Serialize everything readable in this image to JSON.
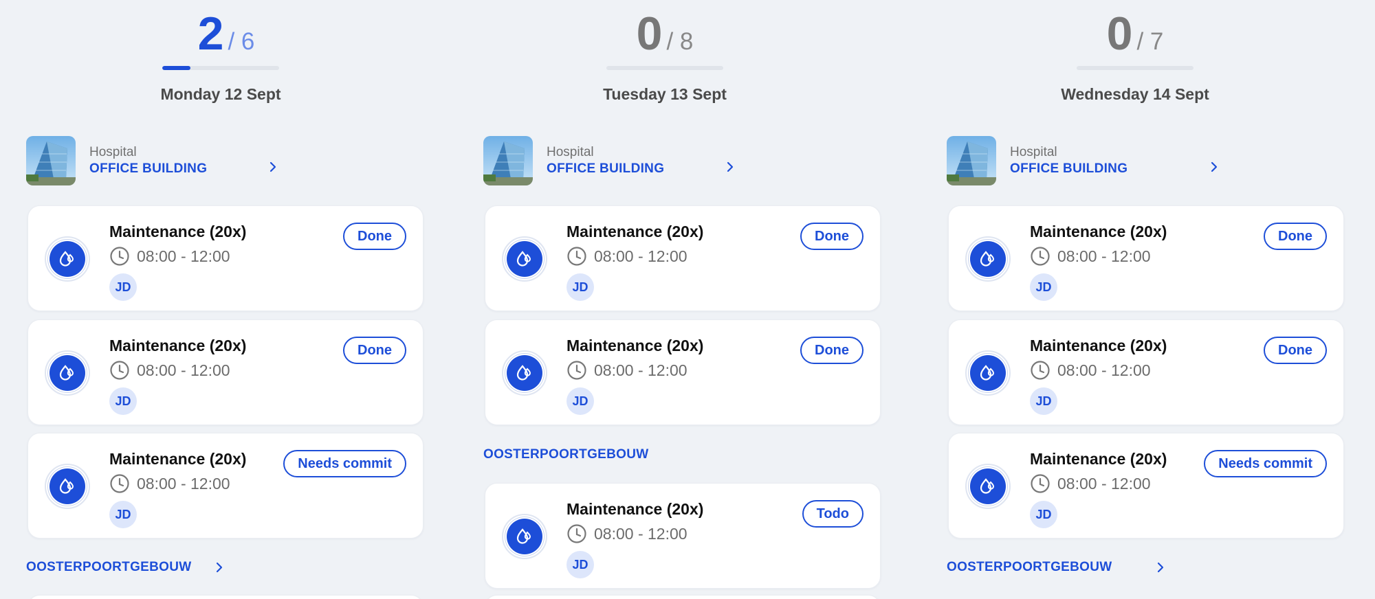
{
  "columns": [
    {
      "done": "2",
      "total": "/ 6",
      "progress": 0.33,
      "day": "Monday 12 Sept",
      "building": {
        "type": "Hospital",
        "name": "OFFICE BUILDING"
      },
      "tasks": [
        {
          "title": "Maintenance (20x)",
          "time": "08:00 - 12:00",
          "assignee": "JD",
          "status": "Done"
        },
        {
          "title": "Maintenance (20x)",
          "time": "08:00 - 12:00",
          "assignee": "JD",
          "status": "Done"
        },
        {
          "title": "Maintenance (20x)",
          "time": "08:00 - 12:00",
          "assignee": "JD",
          "status": "Needs commit"
        }
      ],
      "group": "OOSTERPOORTGEBOUW"
    },
    {
      "done": "0",
      "total": "/ 8",
      "progress": 0,
      "day": "Tuesday 13 Sept",
      "building": {
        "type": "Hospital",
        "name": "OFFICE BUILDING"
      },
      "tasks": [
        {
          "title": "Maintenance (20x)",
          "time": "08:00 - 12:00",
          "assignee": "JD",
          "status": "Done"
        },
        {
          "title": "Maintenance (20x)",
          "time": "08:00 - 12:00",
          "assignee": "JD",
          "status": "Done"
        },
        {
          "title": "Maintenance (20x)",
          "time": "08:00 - 12:00",
          "assignee": "JD",
          "status": "Todo"
        }
      ],
      "group": "OOSTERPOORTGEBOUW"
    },
    {
      "done": "0",
      "total": "/ 7",
      "progress": 0,
      "day": "Wednesday 14 Sept",
      "building": {
        "type": "Hospital",
        "name": "OFFICE BUILDING"
      },
      "tasks": [
        {
          "title": "Maintenance (20x)",
          "time": "08:00 - 12:00",
          "assignee": "JD",
          "status": "Done"
        },
        {
          "title": "Maintenance (20x)",
          "time": "08:00 - 12:00",
          "assignee": "JD",
          "status": "Done"
        },
        {
          "title": "Maintenance (20x)",
          "time": "08:00 - 12:00",
          "assignee": "JD",
          "status": "Needs commit"
        }
      ],
      "group": "OOSTERPOORTGEBOUW"
    }
  ]
}
